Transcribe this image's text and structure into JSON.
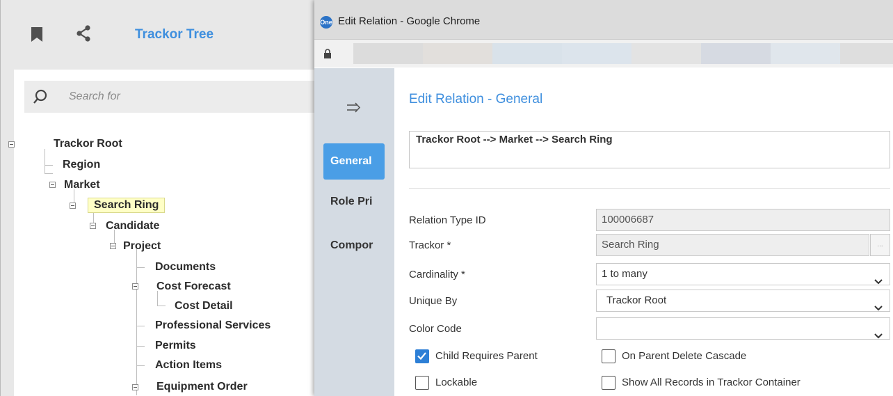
{
  "tree_panel": {
    "title": "Trackor Tree",
    "search_placeholder": "Search for",
    "nodes": [
      "Trackor Root",
      "Region",
      "Market",
      "Search Ring",
      "Candidate",
      "Project",
      "Documents",
      "Cost Forecast",
      "Cost Detail",
      "Professional Services",
      "Permits",
      "Action Items",
      "Equipment Order"
    ]
  },
  "window": {
    "app_badge": "One",
    "title": "Edit Relation - Google Chrome"
  },
  "nav": {
    "tabs": [
      "General",
      "Role Pri",
      "Compor"
    ]
  },
  "form": {
    "section_title": "Edit Relation - General",
    "path": "Trackor Root --> Market --> Search Ring",
    "fields": {
      "relation_type_id": {
        "label": "Relation Type ID",
        "value": "100006687"
      },
      "trackor": {
        "label": "Trackor *",
        "value": "Search Ring",
        "lookup": "..."
      },
      "cardinality": {
        "label": "Cardinality  *",
        "value": "1 to many"
      },
      "unique_by": {
        "label": "Unique By",
        "value": "Trackor Root"
      },
      "color_code": {
        "label": "Color Code",
        "value": ""
      }
    },
    "checkboxes": {
      "child_requires_parent": {
        "label": "Child Requires Parent",
        "checked": true
      },
      "on_parent_delete_cascade": {
        "label": "On Parent Delete Cascade",
        "checked": false
      },
      "lockable": {
        "label": "Lockable",
        "checked": false
      },
      "show_all_records": {
        "label": "Show All Records in Trackor Container",
        "checked": false
      }
    }
  },
  "colors": {
    "accent": "#3f8fde",
    "active_tab": "#4a9ee6",
    "selected_node_bg": "#ffffc6",
    "nav_rail": "#d4dbe3"
  }
}
